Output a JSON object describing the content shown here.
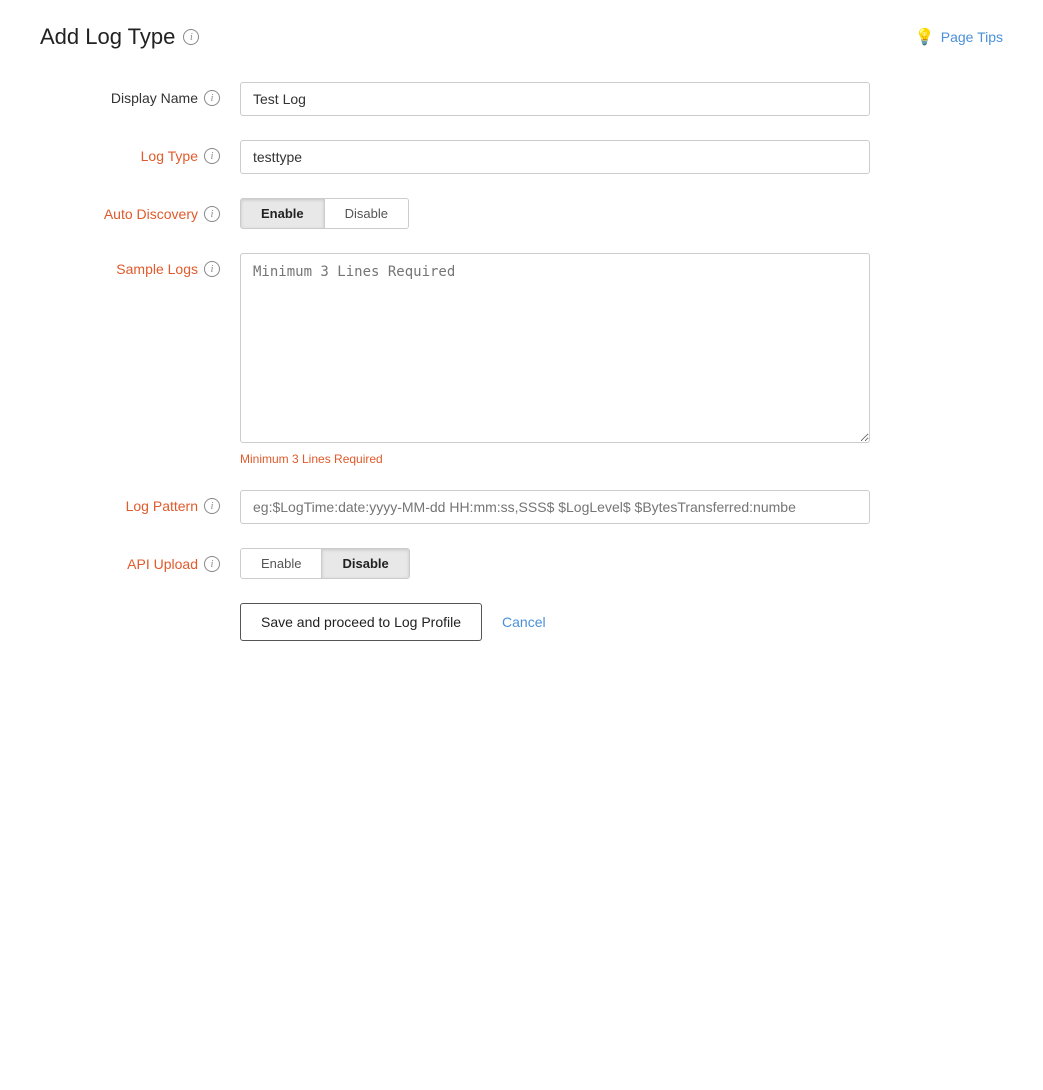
{
  "page": {
    "title": "Add Log Type",
    "page_tips_label": "Page Tips"
  },
  "form": {
    "display_name": {
      "label": "Display Name",
      "value": "Test Log",
      "required": false
    },
    "log_type": {
      "label": "Log Type",
      "value": "testtype",
      "required": true
    },
    "auto_discovery": {
      "label": "Auto Discovery",
      "required": true,
      "options": [
        "Enable",
        "Disable"
      ],
      "selected": "Enable"
    },
    "sample_logs": {
      "label": "Sample Logs",
      "required": true,
      "placeholder": "Minimum 3 Lines Required",
      "error": "Minimum 3 Lines Required"
    },
    "log_pattern": {
      "label": "Log Pattern",
      "required": true,
      "placeholder": "eg:$LogTime:date:yyyy-MM-dd HH:mm:ss,SSS$ $LogLevel$ $BytesTransferred:numbe"
    },
    "api_upload": {
      "label": "API Upload",
      "required": true,
      "options": [
        "Enable",
        "Disable"
      ],
      "selected": "Disable"
    }
  },
  "actions": {
    "save_label": "Save and proceed to Log Profile",
    "cancel_label": "Cancel"
  }
}
